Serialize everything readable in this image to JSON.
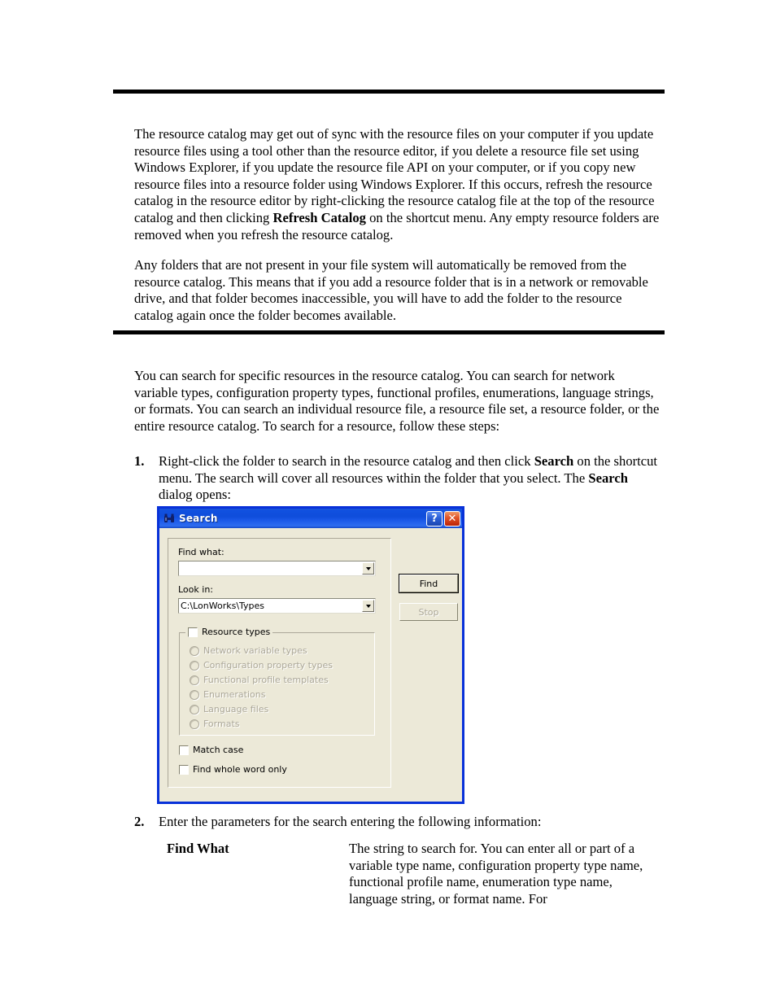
{
  "page": {
    "paragraphs": {
      "p1_part1": "The resource catalog may get out of sync with the resource files on your computer if you update resource files using a tool other than the resource editor, if you delete a resource file set using Windows Explorer, if you update the resource file API on your computer, or if you copy new resource files into a resource folder using Windows Explorer.  If this occurs, refresh the resource catalog in the resource editor by right-clicking the resource catalog file at the top of the resource catalog and then clicking ",
      "p1_bold": "Refresh Catalog",
      "p1_part2": " on the shortcut menu.  Any empty resource folders are removed when you refresh the resource catalog.",
      "p2": "Any folders that are not present in your file system will automatically be removed from the resource catalog.  This means that if you add a resource folder that is in a network or removable drive, and that folder becomes inaccessible, you will have to add the folder to the resource catalog again once the folder becomes available.",
      "p3": "You can search for specific resources in the resource catalog.  You can search for network variable types, configuration property types, functional profiles, enumerations, language strings, or formats.  You can search an individual resource file, a resource file set, a resource folder, or the entire resource catalog.  To search for a resource, follow these steps:"
    },
    "steps": [
      {
        "number": "1.",
        "text_part1": "Right-click the folder to search in the resource catalog and then click ",
        "bold1": "Search",
        "text_part2": " on the shortcut menu.  The search will cover all resources within the folder that you select.  The ",
        "bold2": "Search",
        "text_part3": " dialog opens:"
      },
      {
        "number": "2.",
        "text_part1": "Enter the parameters for the search entering the following information:",
        "bold1": "",
        "text_part2": "",
        "bold2": "",
        "text_part3": ""
      }
    ],
    "definition": {
      "term": "Find What",
      "description": "The string to search for.  You can enter all or part of a variable type name, configuration property type name, functional profile name, enumeration type name, language string, or format name.  For"
    }
  },
  "dialog": {
    "title": "Search",
    "title_icon": "binoculars-icon",
    "titlebar_buttons": {
      "help": "?",
      "close": "✕"
    },
    "fields": {
      "find_what_label": "Find what:",
      "find_what_value": "",
      "look_in_label": "Look in:",
      "look_in_value": "C:\\LonWorks\\Types"
    },
    "resource_types_group": {
      "label": "Resource types",
      "checked": false,
      "options": [
        "Network variable types",
        "Configuration property types",
        "Functional profile templates",
        "Enumerations",
        "Language files",
        "Formats"
      ],
      "options_enabled": false
    },
    "checkboxes": [
      {
        "label": "Match case",
        "checked": false
      },
      {
        "label": "Find whole word only",
        "checked": false
      }
    ],
    "buttons": [
      {
        "label": "Find",
        "enabled": true,
        "default": true
      },
      {
        "label": "Stop",
        "enabled": false,
        "default": false
      }
    ],
    "colors": {
      "titlebar_blue": "#0f4ddb",
      "dialog_face": "#ece9d8",
      "border_blue": "#0831d9",
      "close_red": "#e2562a",
      "disabled_grey": "#aca899"
    }
  }
}
